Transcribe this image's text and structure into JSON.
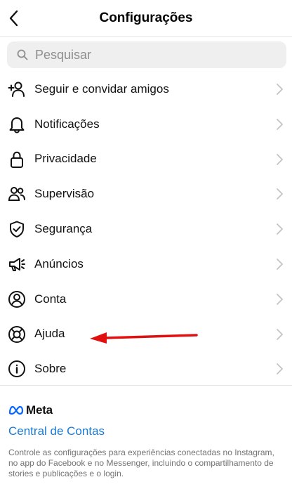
{
  "header": {
    "title": "Configurações"
  },
  "search": {
    "placeholder": "Pesquisar"
  },
  "menu": [
    {
      "label": "Seguir e convidar amigos",
      "icon": "add-person-icon"
    },
    {
      "label": "Notificações",
      "icon": "bell-icon"
    },
    {
      "label": "Privacidade",
      "icon": "lock-icon"
    },
    {
      "label": "Supervisão",
      "icon": "people-icon"
    },
    {
      "label": "Segurança",
      "icon": "shield-icon"
    },
    {
      "label": "Anúncios",
      "icon": "megaphone-icon"
    },
    {
      "label": "Conta",
      "icon": "account-icon"
    },
    {
      "label": "Ajuda",
      "icon": "lifebuoy-icon"
    },
    {
      "label": "Sobre",
      "icon": "info-icon"
    }
  ],
  "meta": {
    "brand": "Meta",
    "link": "Central de Contas",
    "description": "Controle as configurações para experiências conectadas no Instagram, no app do Facebook e no Messenger, incluindo o compartilhamento de stories e publicações e o login."
  },
  "colors": {
    "link": "#1b7ad1",
    "annotation_arrow": "#e01010",
    "meta_logo": "#0866ff"
  }
}
